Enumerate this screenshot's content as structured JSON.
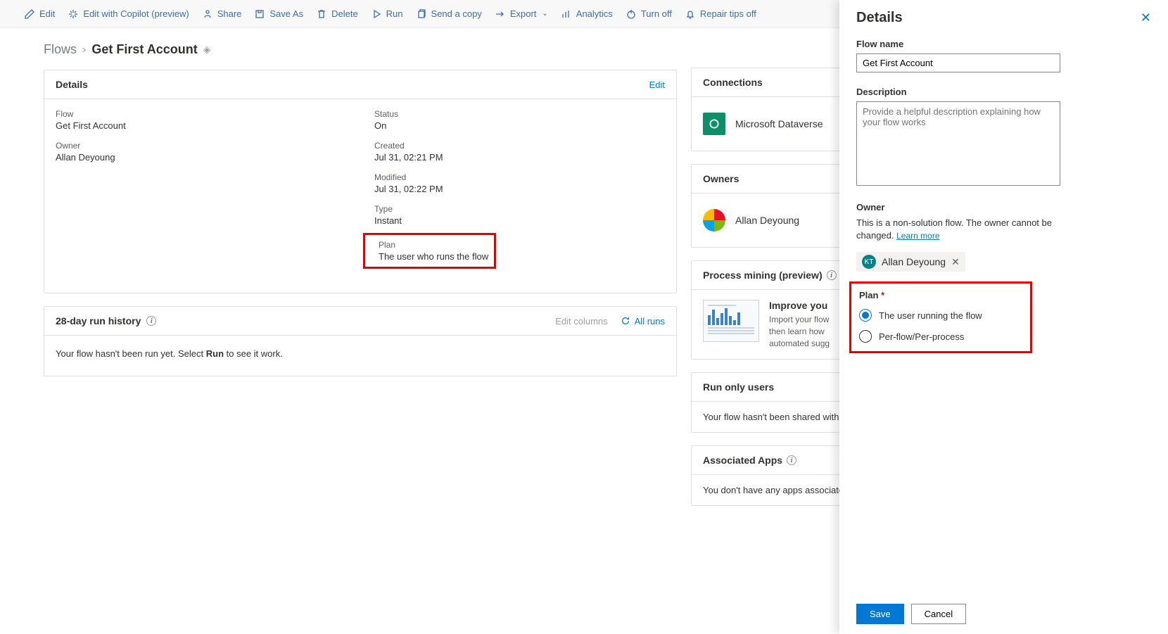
{
  "toolbar": {
    "edit": "Edit",
    "edit_copilot": "Edit with Copilot (preview)",
    "share": "Share",
    "save_as": "Save As",
    "delete": "Delete",
    "run": "Run",
    "send_copy": "Send a copy",
    "export": "Export",
    "analytics": "Analytics",
    "turn_off": "Turn off",
    "repair_tips": "Repair tips off"
  },
  "breadcrumb": {
    "root": "Flows",
    "current": "Get First Account"
  },
  "details": {
    "header": "Details",
    "edit_link": "Edit",
    "flow_label": "Flow",
    "flow_value": "Get First Account",
    "owner_label": "Owner",
    "owner_value": "Allan Deyoung",
    "status_label": "Status",
    "status_value": "On",
    "created_label": "Created",
    "created_value": "Jul 31, 02:21 PM",
    "modified_label": "Modified",
    "modified_value": "Jul 31, 02:22 PM",
    "type_label": "Type",
    "type_value": "Instant",
    "plan_label": "Plan",
    "plan_value": "The user who runs the flow"
  },
  "history": {
    "title": "28-day run history",
    "edit_cols": "Edit columns",
    "all_runs": "All runs",
    "empty_a": "Your flow hasn't been run yet. Select ",
    "empty_b": "Run",
    "empty_c": " to see it work."
  },
  "connections": {
    "title": "Connections",
    "item1": "Microsoft Dataverse"
  },
  "owners_card": {
    "title": "Owners",
    "name": "Allan Deyoung"
  },
  "process_mining": {
    "title": "Process mining (preview)",
    "heading": "Improve you",
    "line1": "Import your flow",
    "line2": "then learn how",
    "line3": "automated sugg"
  },
  "run_only": {
    "title": "Run only users",
    "text": "Your flow hasn't been shared with"
  },
  "assoc_apps": {
    "title": "Associated Apps",
    "text": "You don't have any apps associate"
  },
  "panel": {
    "title": "Details",
    "flow_name_label": "Flow name",
    "flow_name_value": "Get First Account",
    "description_label": "Description",
    "description_placeholder": "Provide a helpful description explaining how your flow works",
    "owner_label": "Owner",
    "owner_note": "This is a non-solution flow. The owner cannot be changed.",
    "learn_more": "Learn more",
    "owner_chip_initials": "KT",
    "owner_chip_name": "Allan Deyoung",
    "plan_label": "Plan",
    "plan_opt1": "The user running the flow",
    "plan_opt2": "Per-flow/Per-process",
    "save": "Save",
    "cancel": "Cancel"
  }
}
